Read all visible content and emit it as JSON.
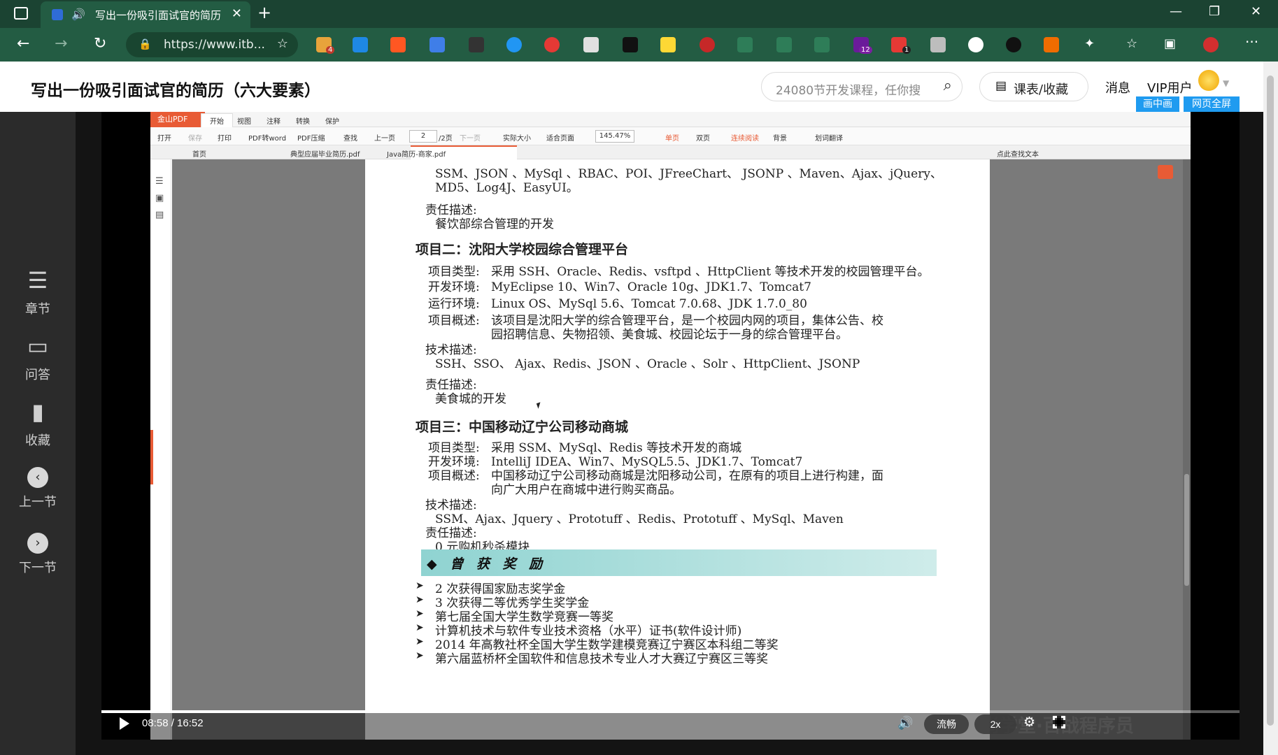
{
  "browser": {
    "tab_title": "写出一份吸引面试官的简历",
    "tab_close": "✕",
    "new_tab": "+",
    "url": "https://www.itb...",
    "back": "←",
    "forward": "→",
    "reload": "↻",
    "minimize": "—",
    "restore": "❐",
    "close": "✕",
    "badges": {
      "ext1": "4",
      "ext2": "12",
      "ext3": "1"
    },
    "profile_color": "#d32f2f"
  },
  "site": {
    "title": "写出一份吸引面试官的简历（六大要素）",
    "search_placeholder": "24080节开发课程，任你搜",
    "courses_label": "课表/收藏",
    "messages_label": "消息",
    "vip_label": "VIP用户",
    "pip_label": "画中画",
    "fullpage_label": "网页全屏"
  },
  "sidebar": {
    "items": [
      {
        "label": "章节",
        "icon": "chapters-icon"
      },
      {
        "label": "问答",
        "icon": "qa-icon"
      },
      {
        "label": "收藏",
        "icon": "bookmark-icon"
      },
      {
        "label": "上一节",
        "icon": "chevron-left-icon"
      },
      {
        "label": "下一节",
        "icon": "chevron-right-icon"
      }
    ]
  },
  "pdf": {
    "app_name": "金山PDF",
    "menus": [
      "开始",
      "视图",
      "注释",
      "转换",
      "保护"
    ],
    "tools": {
      "open": "打开",
      "save": "保存",
      "print": "打印",
      "to_word": "PDF转word",
      "compress": "PDF压缩",
      "find": "查找",
      "prev": "上一页",
      "page": "2",
      "page_total": "/2页",
      "next": "下一页",
      "actual": "实际大小",
      "fit": "适合页面",
      "zoom": "145.47%",
      "single": "单页",
      "double": "双页",
      "continuous": "连续阅读",
      "background": "背景",
      "translate": "划词翻译"
    },
    "tabs": [
      "首页",
      "典型应届毕业简历.pdf",
      "Java简历-商家.pdf"
    ],
    "find_text": "点此查找文本",
    "page": {
      "l1": "SSM、JSON 、MySql 、RBAC、POI、JFreeChart、 JSONP 、Maven、Ajax、jQuery、",
      "l2": "MD5、Log4J、EasyUI。",
      "resp_label": "责任描述:",
      "resp1": "餐饮部综合管理的开发",
      "proj2": "项目二：沈阳大学校园综合管理平台",
      "type_label": "项目类型:",
      "dev_label": "开发环境:",
      "run_label": "运行环境:",
      "overview_label": "项目概述:",
      "tech_label": "技术描述:",
      "p2_type": "采用 SSH、Oracle、Redis、vsftpd 、HttpClient 等技术开发的校园管理平台。",
      "p2_dev": "MyEclipse 10、Win7、Oracle 10g、JDK1.7、Tomcat7",
      "p2_run": "Linux OS、MySql 5.6、Tomcat 7.0.68、JDK 1.7.0_80",
      "p2_ov1": "该项目是沈阳大学的综合管理平台，是一个校园内网的项目，集体公告、校",
      "p2_ov2": "园招聘信息、失物招领、美食城、校园论坛于一身的综合管理平台。",
      "p2_tech": "SSH、SSO、 Ajax、Redis、JSON 、Oracle 、Solr 、HttpClient、JSONP",
      "p2_resp": "美食城的开发",
      "proj3": "项目三：中国移动辽宁公司移动商城",
      "p3_type": "采用 SSM、MySql、Redis 等技术开发的商城",
      "p3_dev": "IntelliJ IDEA、Win7、MySQL5.5、JDK1.7、Tomcat7",
      "p3_ov1": "中国移动辽宁公司移动商城是沈阳移动公司，在原有的项目上进行构建，面",
      "p3_ov2": "向广大用户在商城中进行购买商品。",
      "p3_tech": "SSM、Ajax、Jquery 、Prototuff 、Redis、Prototuff 、MySql、Maven",
      "p3_resp": "0 元购机秒杀模块",
      "awards_title": "◆ 曾 获 奖 励",
      "award1": "2 次获得国家励志奖学金",
      "award2": "3 次获得二等优秀学生奖学金",
      "award3": "第七届全国大学生数学竞赛一等奖",
      "award4": "计算机技术与软件专业技术资格（水平）证书(软件设计师)",
      "award5": "2014 年高教社杯全国大学生数学建模竞赛辽宁赛区本科组二等奖",
      "award6": "第六届蓝桥杯全国软件和信息技术专业人才大赛辽宁赛区三等奖",
      "bullet": "➤"
    }
  },
  "player": {
    "time": "08:58 / 16:52",
    "progress": 0.532,
    "quality": "流畅",
    "speed": "2x",
    "watermark": "尚学堂·百战程序员"
  }
}
